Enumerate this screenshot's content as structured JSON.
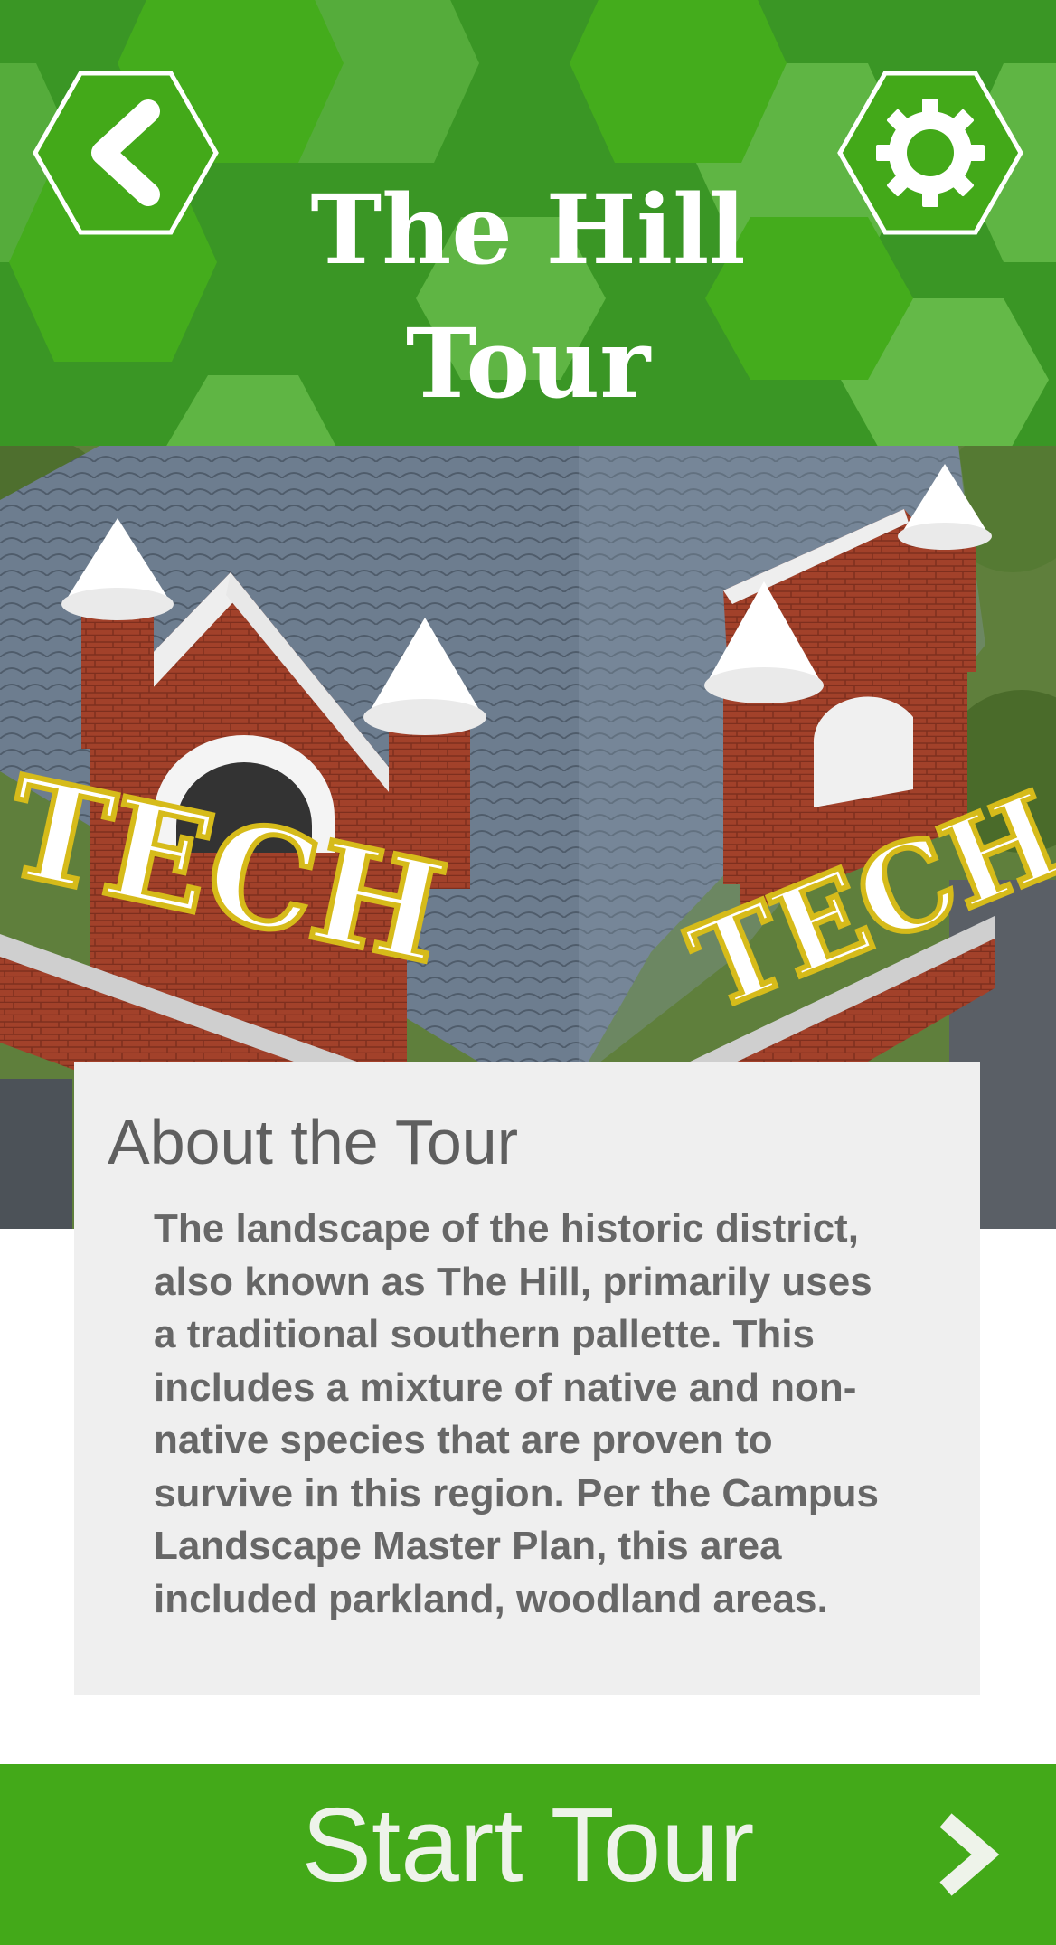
{
  "header": {
    "title_line1": "The Hill",
    "title_line2": "Tour",
    "back_icon": "chevron-left-icon",
    "settings_icon": "gear-icon"
  },
  "hero": {
    "sign_text_left": "TECH",
    "sign_text_right": "TECH"
  },
  "about": {
    "heading": "About the Tour",
    "body": "The landscape of the historic district, also known as The Hill, primarily uses a traditional southern pallette. This includes a mixture of native and non-native species that are proven to survive in this region. Per the Campus Landscape Master Plan, this area included parkland, woodland areas."
  },
  "footer": {
    "start_label": "Start Tour",
    "start_icon": "chevron-right-icon"
  },
  "colors": {
    "header_green": "#3a9625",
    "hex_light": "#6cbf4f",
    "hex_mid": "#44ac1c",
    "button_green": "#43a919",
    "card_bg": "#efefef",
    "text_gray": "#676767",
    "brick": "#9c3b27",
    "roof_slate": "#6d7d8f",
    "sign_gold": "#d6bb1a"
  }
}
